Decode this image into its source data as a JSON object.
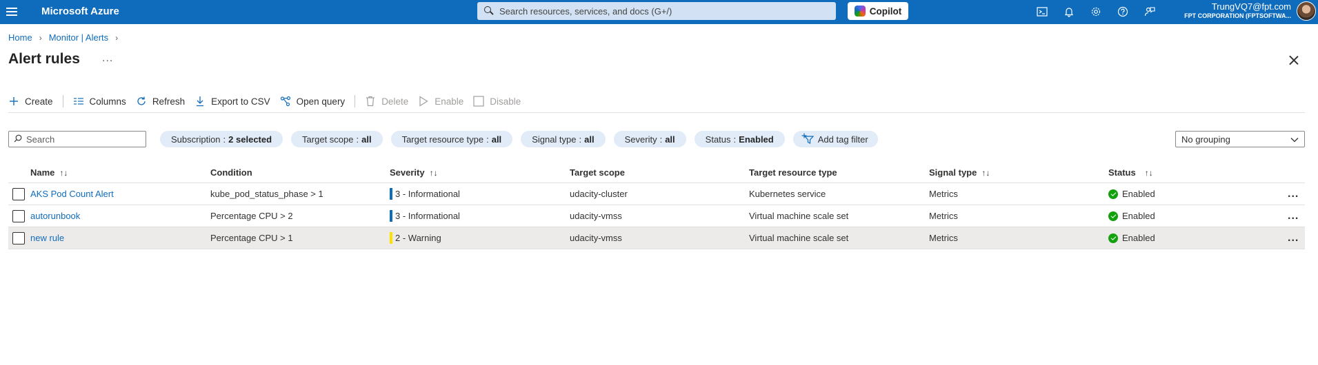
{
  "header": {
    "brand": "Microsoft Azure",
    "search_placeholder": "Search resources, services, and docs (G+/)",
    "copilot_label": "Copilot",
    "icons": [
      "cloud-shell-icon",
      "notifications-icon",
      "settings-icon",
      "help-icon",
      "feedback-icon"
    ],
    "account_email": "TrungVQ7@fpt.com",
    "account_org": "FPT CORPORATION (FPTSOFTWA..."
  },
  "breadcrumb": {
    "home": "Home",
    "parent": "Monitor | Alerts"
  },
  "page": {
    "title": "Alert rules",
    "more": "..."
  },
  "toolbar": {
    "create": "Create",
    "columns": "Columns",
    "refresh": "Refresh",
    "export": "Export to CSV",
    "open_query": "Open query",
    "delete": "Delete",
    "enable": "Enable",
    "disable": "Disable"
  },
  "filters": {
    "search_placeholder": "Search",
    "subscription": {
      "label": "Subscription",
      "value": "2 selected"
    },
    "target_scope": {
      "label": "Target scope",
      "value": "all"
    },
    "target_resource_type": {
      "label": "Target resource type",
      "value": "all"
    },
    "signal_type": {
      "label": "Signal type",
      "value": "all"
    },
    "severity": {
      "label": "Severity",
      "value": "all"
    },
    "status": {
      "label": "Status",
      "value": "Enabled"
    },
    "add_tag": "Add tag filter",
    "grouping": "No grouping"
  },
  "table": {
    "columns": {
      "name": "Name",
      "condition": "Condition",
      "severity": "Severity",
      "target_scope": "Target scope",
      "target_resource_type": "Target resource type",
      "signal_type": "Signal type",
      "status": "Status"
    },
    "rows": [
      {
        "name": "AKS Pod Count Alert",
        "condition": "kube_pod_status_phase > 1",
        "severity": "3 - Informational",
        "severity_color": "#0f6cbd",
        "target_scope": "udacity-cluster",
        "target_resource_type": "Kubernetes service",
        "signal_type": "Metrics",
        "status": "Enabled",
        "more": "..."
      },
      {
        "name": "autorunbook",
        "condition": "Percentage CPU > 2",
        "severity": "3 - Informational",
        "severity_color": "#0f6cbd",
        "target_scope": "udacity-vmss",
        "target_resource_type": "Virtual machine scale set",
        "signal_type": "Metrics",
        "status": "Enabled",
        "more": "..."
      },
      {
        "name": "new rule",
        "condition": "Percentage CPU > 1",
        "severity": "2 - Warning",
        "severity_color": "#fce100",
        "target_scope": "udacity-vmss",
        "target_resource_type": "Virtual machine scale set",
        "signal_type": "Metrics",
        "status": "Enabled",
        "more": "..."
      }
    ]
  }
}
